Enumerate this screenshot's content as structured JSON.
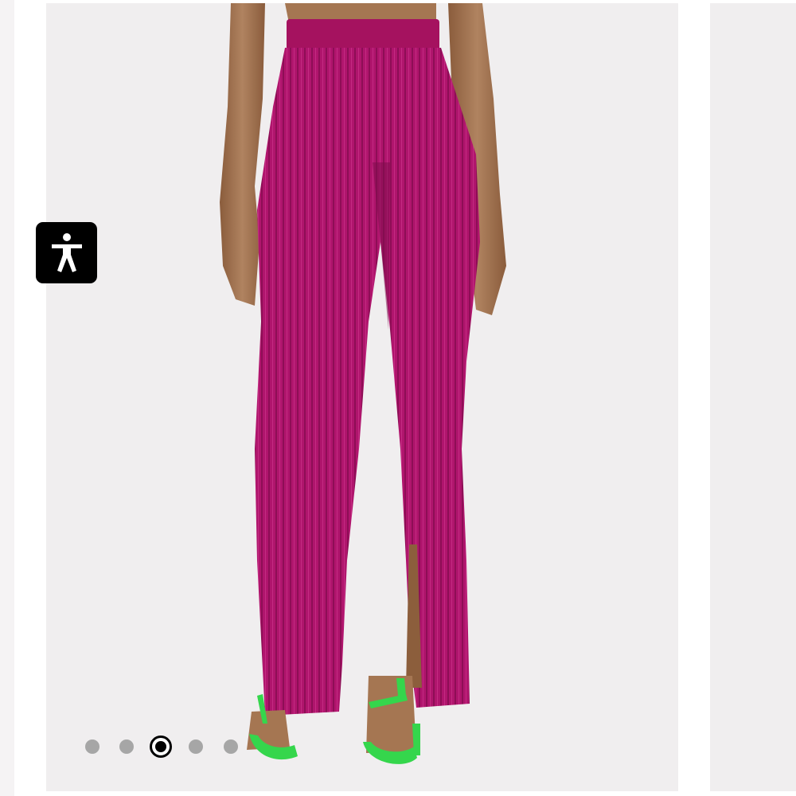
{
  "gallery": {
    "product_image_label": "",
    "slide_count": 5,
    "active_slide_index": 2
  },
  "accessibility": {
    "icon": "accessibility-person-icon"
  },
  "colors": {
    "background": "#f0eeef",
    "pants": "#b0156d",
    "skin": "#a57652",
    "sandals": "#35d64c",
    "dot_inactive": "#a6a6a6",
    "dot_active": "#000000"
  }
}
